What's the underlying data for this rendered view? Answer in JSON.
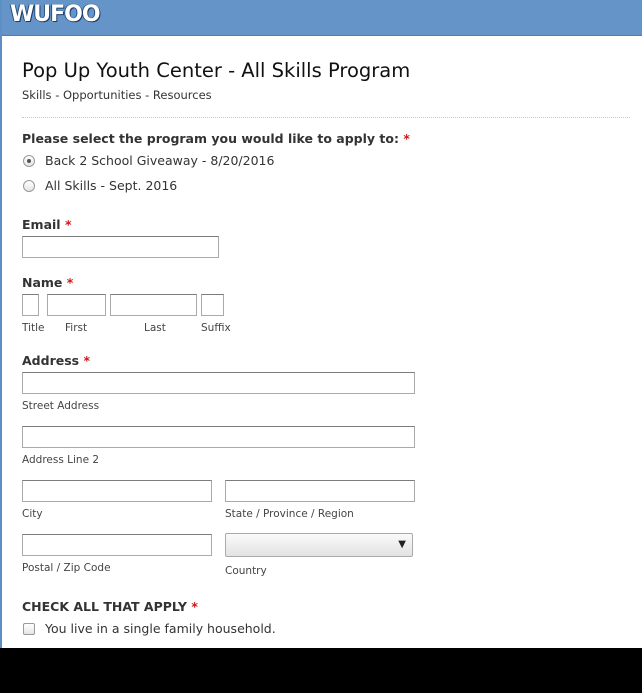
{
  "brand": {
    "logo_text": "WUFOO"
  },
  "form": {
    "title": "Pop Up Youth Center - All Skills Program",
    "description": "Skills - Opportunities - Resources"
  },
  "program": {
    "label": "Please select the program you would like to apply to:",
    "required_mark": "*",
    "options": [
      {
        "label": "Back 2 School Giveaway - 8/20/2016",
        "selected": true
      },
      {
        "label": "All Skills - Sept. 2016",
        "selected": false
      }
    ]
  },
  "email": {
    "label": "Email",
    "required_mark": "*",
    "value": ""
  },
  "name": {
    "label": "Name",
    "required_mark": "*",
    "sublabels": {
      "title": "Title",
      "first": "First",
      "last": "Last",
      "suffix": "Suffix"
    }
  },
  "address": {
    "label": "Address",
    "required_mark": "*",
    "sublabels": {
      "street": "Street Address",
      "line2": "Address Line 2",
      "city": "City",
      "state": "State / Province / Region",
      "zip": "Postal / Zip Code",
      "country": "Country"
    },
    "country_value": ""
  },
  "check_all": {
    "label": "CHECK ALL THAT APPLY",
    "required_mark": "*",
    "options": [
      {
        "label": "You live in a single family household.",
        "checked": false
      }
    ]
  },
  "colors": {
    "topbar": "#6594c9",
    "required": "#d0151b"
  }
}
